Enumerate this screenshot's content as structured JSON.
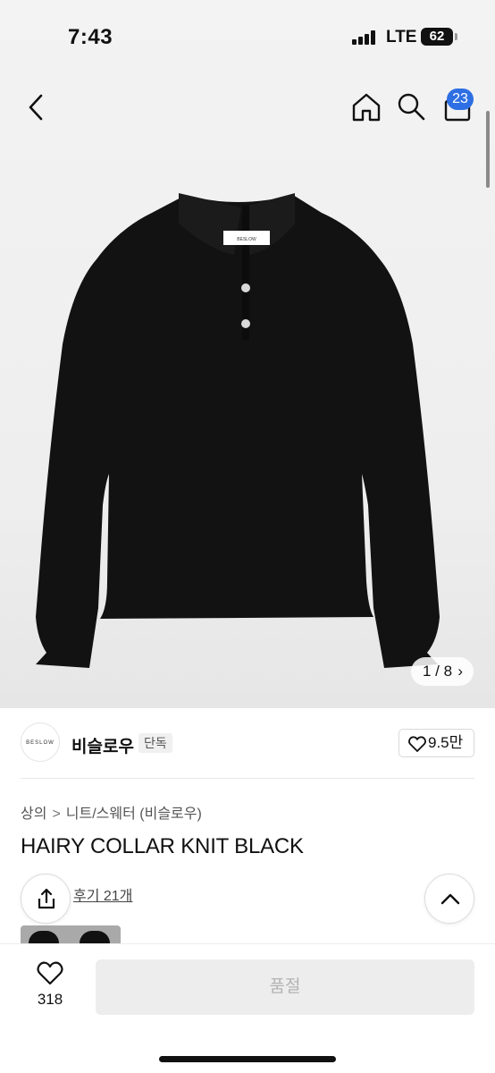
{
  "status_bar": {
    "time": "7:43",
    "carrier": "LTE",
    "battery": "62"
  },
  "nav": {
    "back_icon": "chevron-left-icon",
    "home_icon": "home-icon",
    "search_icon": "search-icon",
    "cart_icon": "shopping-bag-icon",
    "cart_count": "23",
    "cart_badge_color": "#2f6fe4"
  },
  "product_image": {
    "brand_tag": "BESLOW",
    "counter": "1 / 8",
    "counter_next": "›"
  },
  "brand": {
    "logo_text": "BESLOW",
    "name": "비슬로우",
    "badge": "단독",
    "likes": "9.5만"
  },
  "breadcrumb": {
    "category": "상의",
    "separator": ">",
    "subcategory": "니트/스웨터 (비슬로우)"
  },
  "product": {
    "title": "HAIRY COLLAR KNIT BLACK",
    "reviews": "후기 21개"
  },
  "floating": {
    "share_icon": "share-icon",
    "top_icon": "chevron-up-icon"
  },
  "bottom_bar": {
    "wish_icon": "heart-icon",
    "wish_count": "318",
    "cta_label": "품절"
  }
}
